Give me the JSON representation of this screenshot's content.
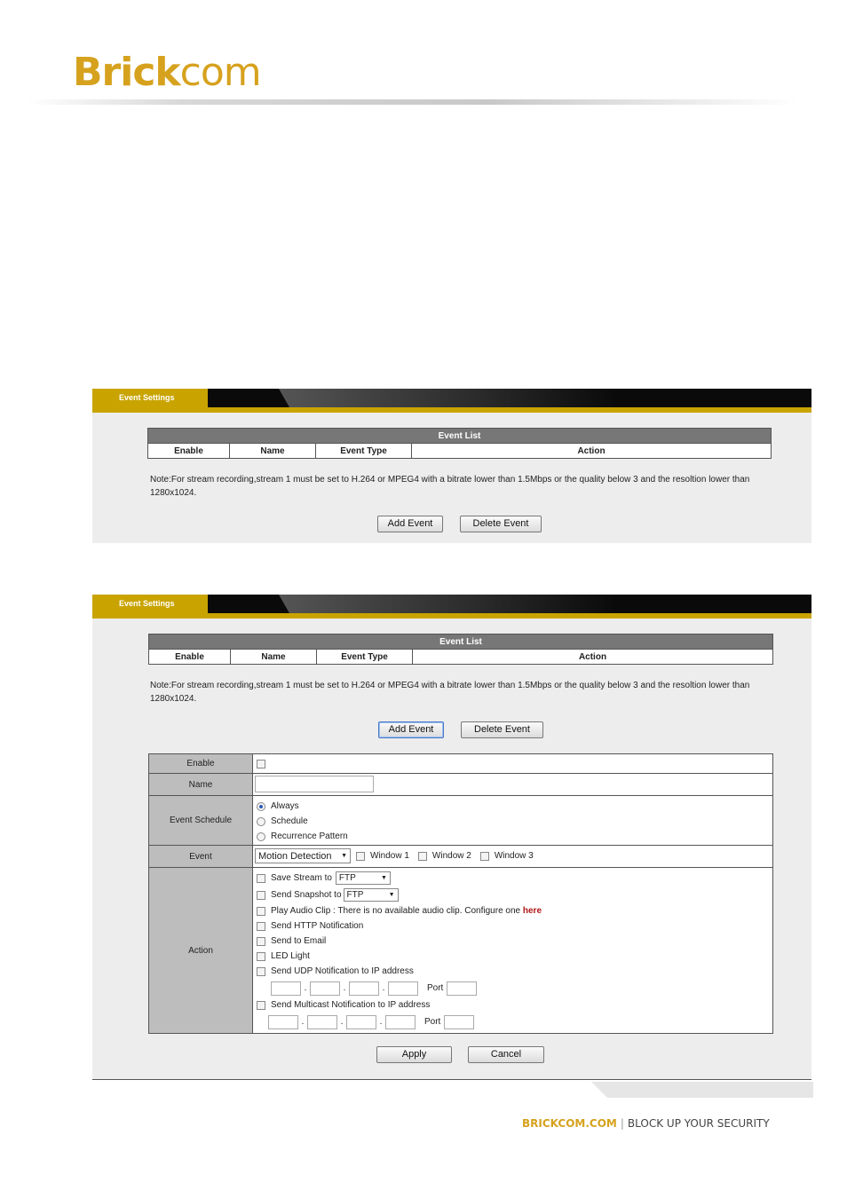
{
  "brand": {
    "part1": "Brick",
    "part2": "com"
  },
  "panel1": {
    "tab_label": "Event Settings",
    "list_caption": "Event List",
    "columns": [
      "Enable",
      "Name",
      "Event Type",
      "Action"
    ],
    "note": "Note:For stream recording,stream 1 must be set to H.264 or MPEG4 with a bitrate lower than 1.5Mbps or the quality below 3 and the resoltion lower than 1280x1024.",
    "add_event": "Add Event",
    "delete_event": "Delete Event"
  },
  "panel2": {
    "tab_label": "Event Settings",
    "list_caption": "Event List",
    "columns": [
      "Enable",
      "Name",
      "Event Type",
      "Action"
    ],
    "note": "Note:For stream recording,stream 1 must be set to H.264 or MPEG4 with a bitrate lower than 1.5Mbps or the quality below 3 and the resoltion lower than 1280x1024.",
    "add_event": "Add Event",
    "delete_event": "Delete Event",
    "form": {
      "enable_label": "Enable",
      "name_label": "Name",
      "name_value": "",
      "schedule_label": "Event Schedule",
      "schedule_options": [
        "Always",
        "Schedule",
        "Recurrence Pattern"
      ],
      "schedule_selected": "Always",
      "event_label": "Event",
      "event_type": "Motion Detection",
      "windows": [
        "Window 1",
        "Window 2",
        "Window 3"
      ],
      "action_label": "Action",
      "save_stream": "Save Stream to",
      "save_stream_target": "FTP",
      "send_snapshot": "Send Snapshot to",
      "send_snapshot_target": "FTP",
      "play_audio": "Play Audio Clip : There is no available audio clip. Configure one",
      "play_audio_link": "here",
      "http_notification": "Send HTTP Notification",
      "send_email": "Send to Email",
      "led_light": "LED Light",
      "udp_notification": "Send UDP Notification to IP address",
      "multicast_notification": "Send Multicast Notification to IP address",
      "port_label": "Port",
      "ip_separator": "."
    },
    "apply": "Apply",
    "cancel": "Cancel"
  },
  "footer": {
    "site": "BRICKCOM.COM",
    "separator": "|",
    "slogan": "BLOCK UP YOUR SECURITY"
  }
}
